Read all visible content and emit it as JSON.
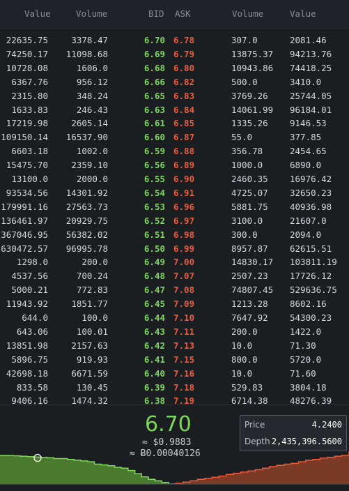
{
  "headers": {
    "bid_value": "Value",
    "bid_volume": "Volume",
    "bid": "BID",
    "ask": "ASK",
    "ask_volume": "Volume",
    "ask_value": "Value"
  },
  "rows": [
    {
      "bid_value": "22635.75",
      "bid_volume": "3378.47",
      "bid": "6.70",
      "ask": "6.78",
      "ask_volume": "307.0",
      "ask_value": "2081.46"
    },
    {
      "bid_value": "74250.17",
      "bid_volume": "11098.68",
      "bid": "6.69",
      "ask": "6.79",
      "ask_volume": "13875.37",
      "ask_value": "94213.76"
    },
    {
      "bid_value": "10728.08",
      "bid_volume": "1606.0",
      "bid": "6.68",
      "ask": "6.80",
      "ask_volume": "10943.86",
      "ask_value": "74418.25"
    },
    {
      "bid_value": "6367.76",
      "bid_volume": "956.12",
      "bid": "6.66",
      "ask": "6.82",
      "ask_volume": "500.0",
      "ask_value": "3410.0"
    },
    {
      "bid_value": "2315.80",
      "bid_volume": "348.24",
      "bid": "6.65",
      "ask": "6.83",
      "ask_volume": "3769.26",
      "ask_value": "25744.05"
    },
    {
      "bid_value": "1633.83",
      "bid_volume": "246.43",
      "bid": "6.63",
      "ask": "6.84",
      "ask_volume": "14061.99",
      "ask_value": "96184.01"
    },
    {
      "bid_value": "17219.98",
      "bid_volume": "2605.14",
      "bid": "6.61",
      "ask": "6.85",
      "ask_volume": "1335.26",
      "ask_value": "9146.53"
    },
    {
      "bid_value": "109150.14",
      "bid_volume": "16537.90",
      "bid": "6.60",
      "ask": "6.87",
      "ask_volume": "55.0",
      "ask_value": "377.85"
    },
    {
      "bid_value": "6603.18",
      "bid_volume": "1002.0",
      "bid": "6.59",
      "ask": "6.88",
      "ask_volume": "356.78",
      "ask_value": "2454.65"
    },
    {
      "bid_value": "15475.70",
      "bid_volume": "2359.10",
      "bid": "6.56",
      "ask": "6.89",
      "ask_volume": "1000.0",
      "ask_value": "6890.0"
    },
    {
      "bid_value": "13100.0",
      "bid_volume": "2000.0",
      "bid": "6.55",
      "ask": "6.90",
      "ask_volume": "2460.35",
      "ask_value": "16976.42"
    },
    {
      "bid_value": "93534.56",
      "bid_volume": "14301.92",
      "bid": "6.54",
      "ask": "6.91",
      "ask_volume": "4725.07",
      "ask_value": "32650.23"
    },
    {
      "bid_value": "179991.16",
      "bid_volume": "27563.73",
      "bid": "6.53",
      "ask": "6.96",
      "ask_volume": "5881.75",
      "ask_value": "40936.98"
    },
    {
      "bid_value": "136461.97",
      "bid_volume": "20929.75",
      "bid": "6.52",
      "ask": "6.97",
      "ask_volume": "3100.0",
      "ask_value": "21607.0"
    },
    {
      "bid_value": "367046.95",
      "bid_volume": "56382.02",
      "bid": "6.51",
      "ask": "6.98",
      "ask_volume": "300.0",
      "ask_value": "2094.0"
    },
    {
      "bid_value": "630472.57",
      "bid_volume": "96995.78",
      "bid": "6.50",
      "ask": "6.99",
      "ask_volume": "8957.87",
      "ask_value": "62615.51"
    },
    {
      "bid_value": "1298.0",
      "bid_volume": "200.0",
      "bid": "6.49",
      "ask": "7.00",
      "ask_volume": "14830.17",
      "ask_value": "103811.19"
    },
    {
      "bid_value": "4537.56",
      "bid_volume": "700.24",
      "bid": "6.48",
      "ask": "7.07",
      "ask_volume": "2507.23",
      "ask_value": "17726.12"
    },
    {
      "bid_value": "5000.21",
      "bid_volume": "772.83",
      "bid": "6.47",
      "ask": "7.08",
      "ask_volume": "74807.45",
      "ask_value": "529636.75"
    },
    {
      "bid_value": "11943.92",
      "bid_volume": "1851.77",
      "bid": "6.45",
      "ask": "7.09",
      "ask_volume": "1213.28",
      "ask_value": "8602.16"
    },
    {
      "bid_value": "644.0",
      "bid_volume": "100.0",
      "bid": "6.44",
      "ask": "7.10",
      "ask_volume": "7647.92",
      "ask_value": "54300.23"
    },
    {
      "bid_value": "643.06",
      "bid_volume": "100.01",
      "bid": "6.43",
      "ask": "7.11",
      "ask_volume": "200.0",
      "ask_value": "1422.0"
    },
    {
      "bid_value": "13851.98",
      "bid_volume": "2157.63",
      "bid": "6.42",
      "ask": "7.13",
      "ask_volume": "10.0",
      "ask_value": "71.30"
    },
    {
      "bid_value": "5896.75",
      "bid_volume": "919.93",
      "bid": "6.41",
      "ask": "7.15",
      "ask_volume": "800.0",
      "ask_value": "5720.0"
    },
    {
      "bid_value": "42698.18",
      "bid_volume": "6671.59",
      "bid": "6.40",
      "ask": "7.16",
      "ask_volume": "10.0",
      "ask_value": "71.60"
    },
    {
      "bid_value": "833.58",
      "bid_volume": "130.45",
      "bid": "6.39",
      "ask": "7.18",
      "ask_volume": "529.83",
      "ask_value": "3804.18"
    },
    {
      "bid_value": "9406.16",
      "bid_volume": "1474.32",
      "bid": "6.38",
      "ask": "7.19",
      "ask_volume": "6714.38",
      "ask_value": "48276.39"
    }
  ],
  "summary": {
    "last_price": "6.70",
    "usd_prefix": "≈ $",
    "usd_value": "0.9883",
    "btc_prefix": "≈ Ƀ",
    "btc_value": "0.00040126"
  },
  "tooltip": {
    "price_label": "Price",
    "price_value": "4.2400",
    "depth_label": "Depth",
    "depth_value": "2,435,396.5600"
  },
  "colors": {
    "bid": "#7ed95a",
    "ask": "#ef5b3b",
    "bid_fill": "#4a7a2e",
    "ask_fill": "#7a3a26",
    "background": "#1b1e21"
  },
  "depth_chart": {
    "bids_from_left": [
      0.72,
      0.72,
      0.71,
      0.7,
      0.69,
      0.68,
      0.67,
      0.66,
      0.64,
      0.64,
      0.62,
      0.6,
      0.58,
      0.56,
      0.5,
      0.48,
      0.46,
      0.42,
      0.4,
      0.34,
      0.26,
      0.18,
      0.12,
      0.08,
      0.04,
      0.0
    ],
    "asks_from_mid": [
      0.0,
      0.02,
      0.05,
      0.08,
      0.12,
      0.14,
      0.17,
      0.2,
      0.24,
      0.27,
      0.3,
      0.33,
      0.36,
      0.4,
      0.44,
      0.47,
      0.5,
      0.52,
      0.56,
      0.6,
      0.62,
      0.65,
      0.67,
      0.7,
      0.72,
      0.82
    ]
  }
}
